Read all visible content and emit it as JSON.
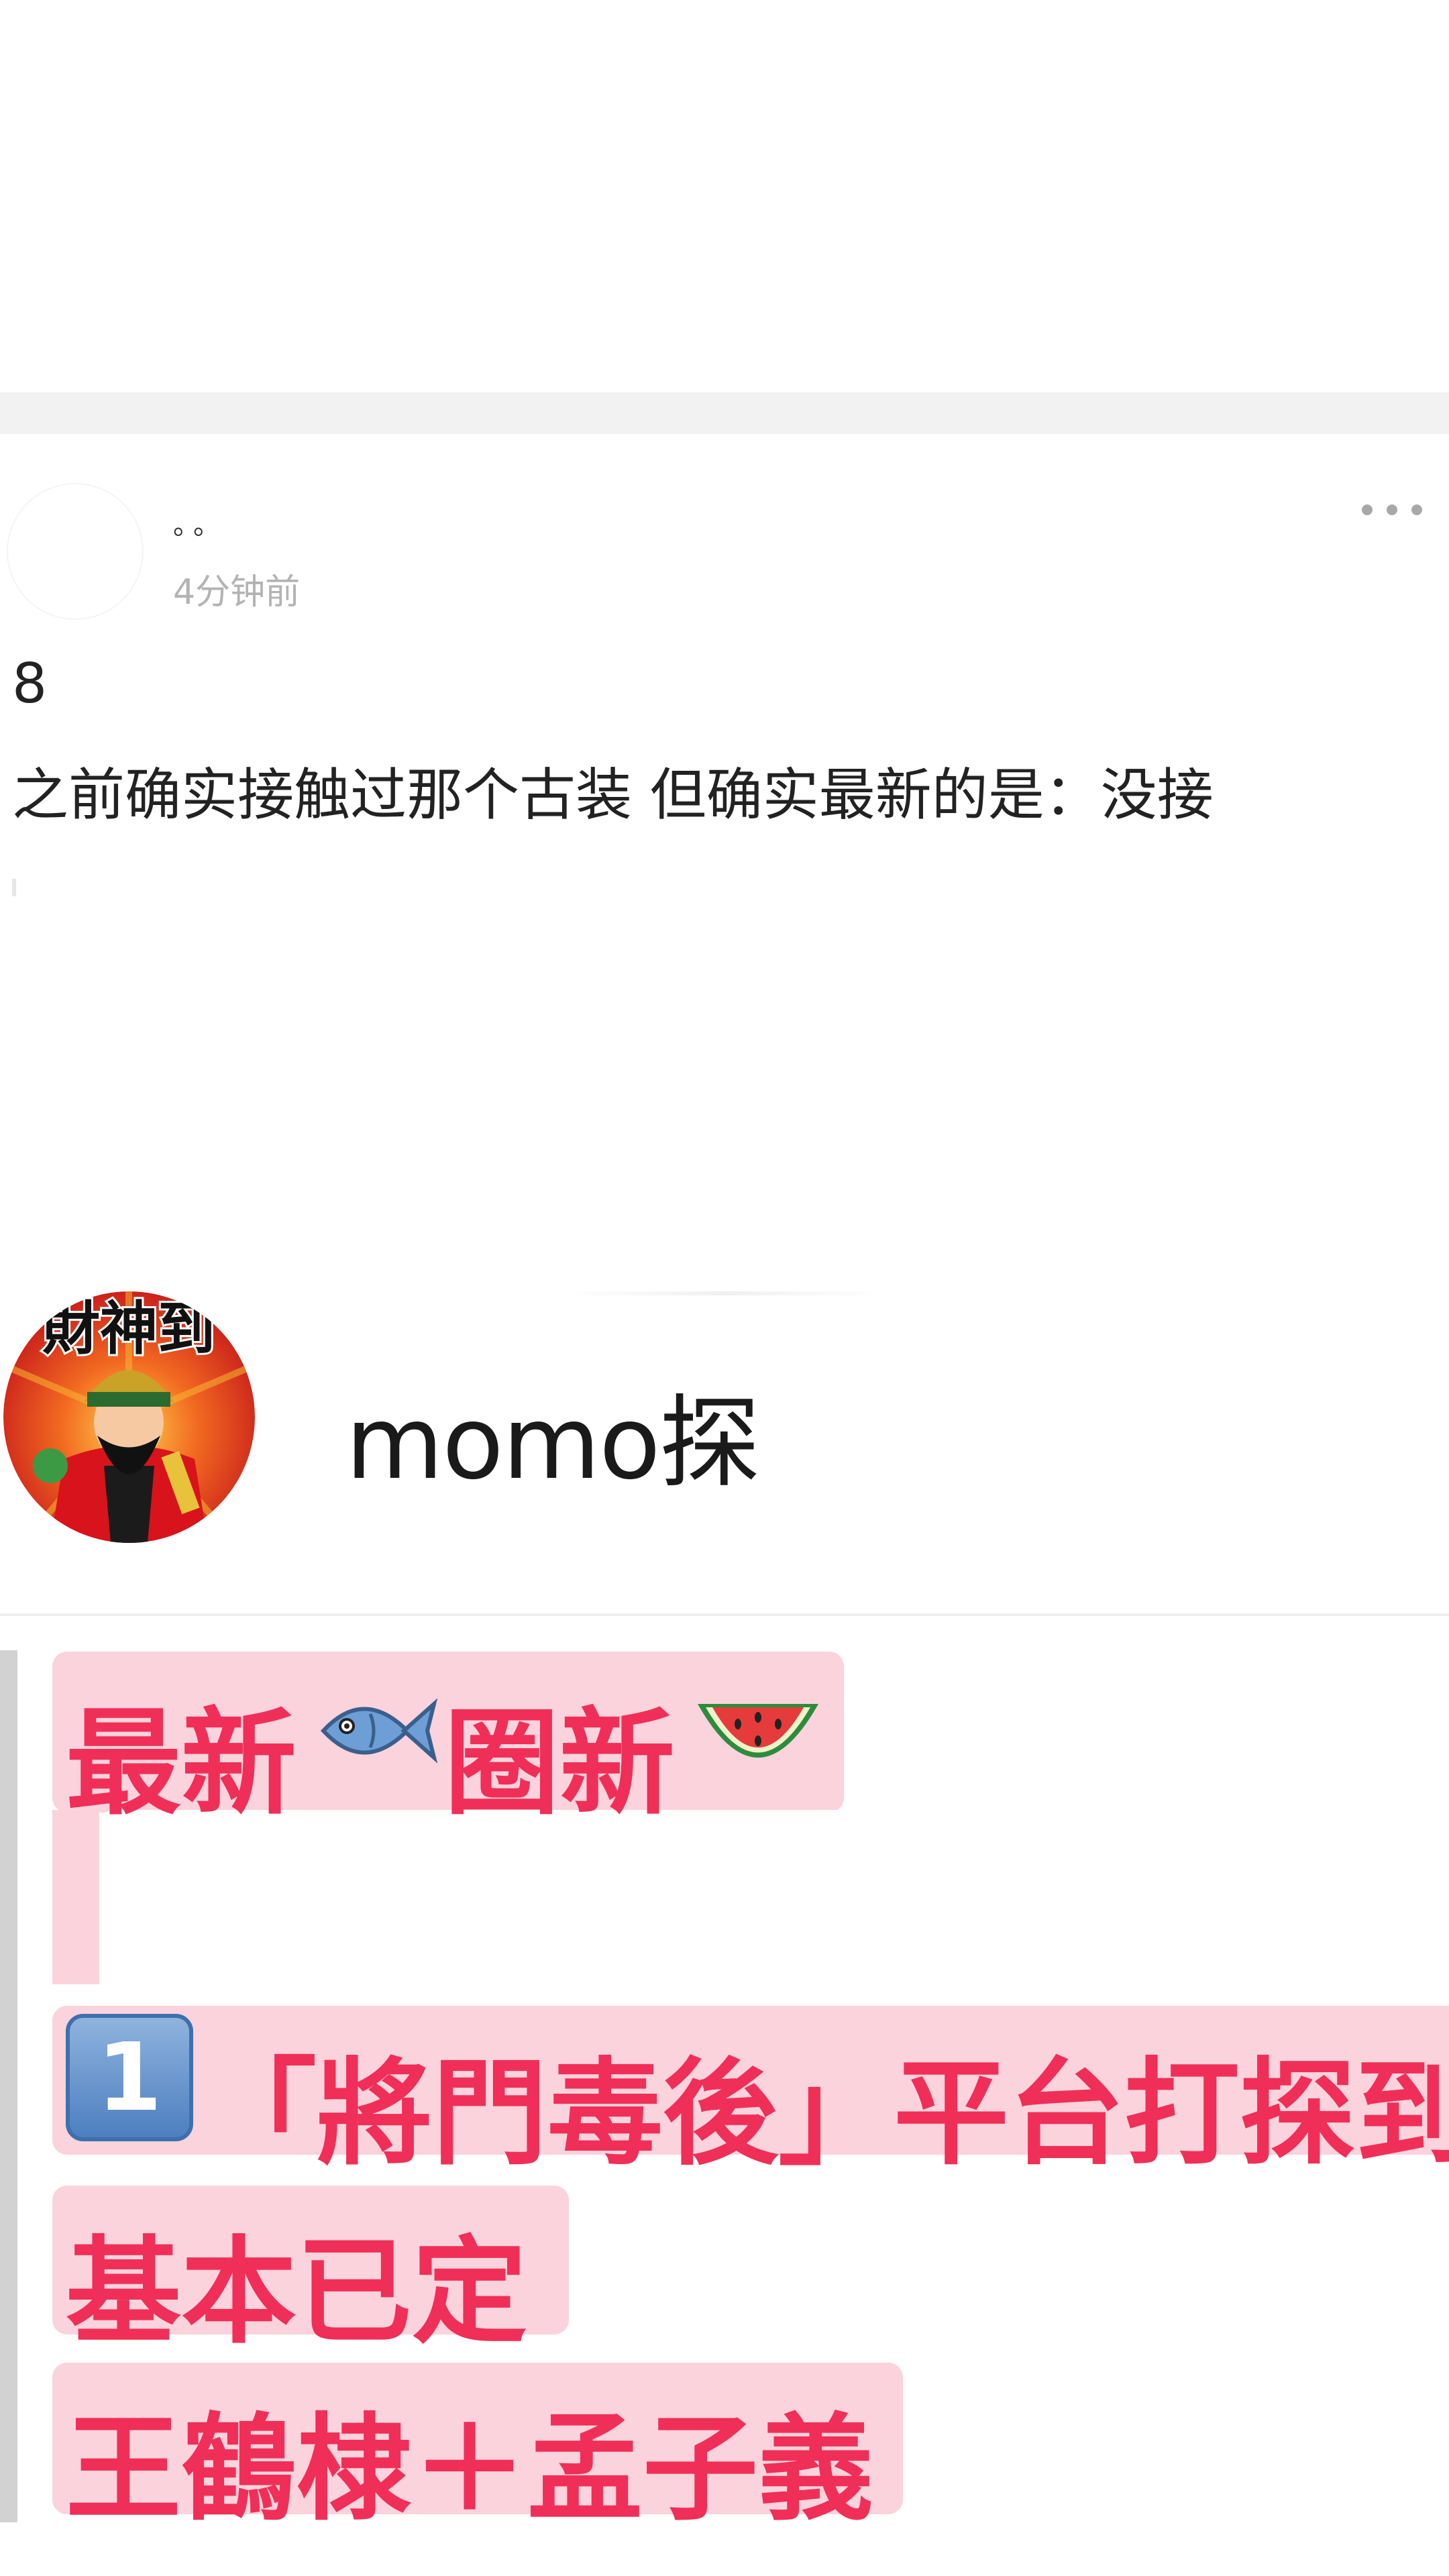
{
  "post": {
    "author": "。。",
    "time": "4分钟前",
    "line1": "8",
    "line2": "之前确实接触过那个古装 但确实最新的是：没接"
  },
  "profile": {
    "name": "momo探",
    "avatar_text": "財神到"
  },
  "message": {
    "line1": "最新",
    "line1b": "圈新",
    "keycap": "1",
    "line2": "「將門毒後」平台打探到",
    "line3": "基本已定",
    "line4": "王鶴棣＋孟子義"
  },
  "colors": {
    "highlight_bg": "#fbd3dc",
    "highlight_text": "#ef2f57",
    "separator": "#f2f2f2"
  },
  "icons": {
    "more": "more-dots-icon",
    "fish": "fish-emoji-icon",
    "melon": "watermelon-emoji-icon",
    "keycap": "keycap-one-icon"
  }
}
